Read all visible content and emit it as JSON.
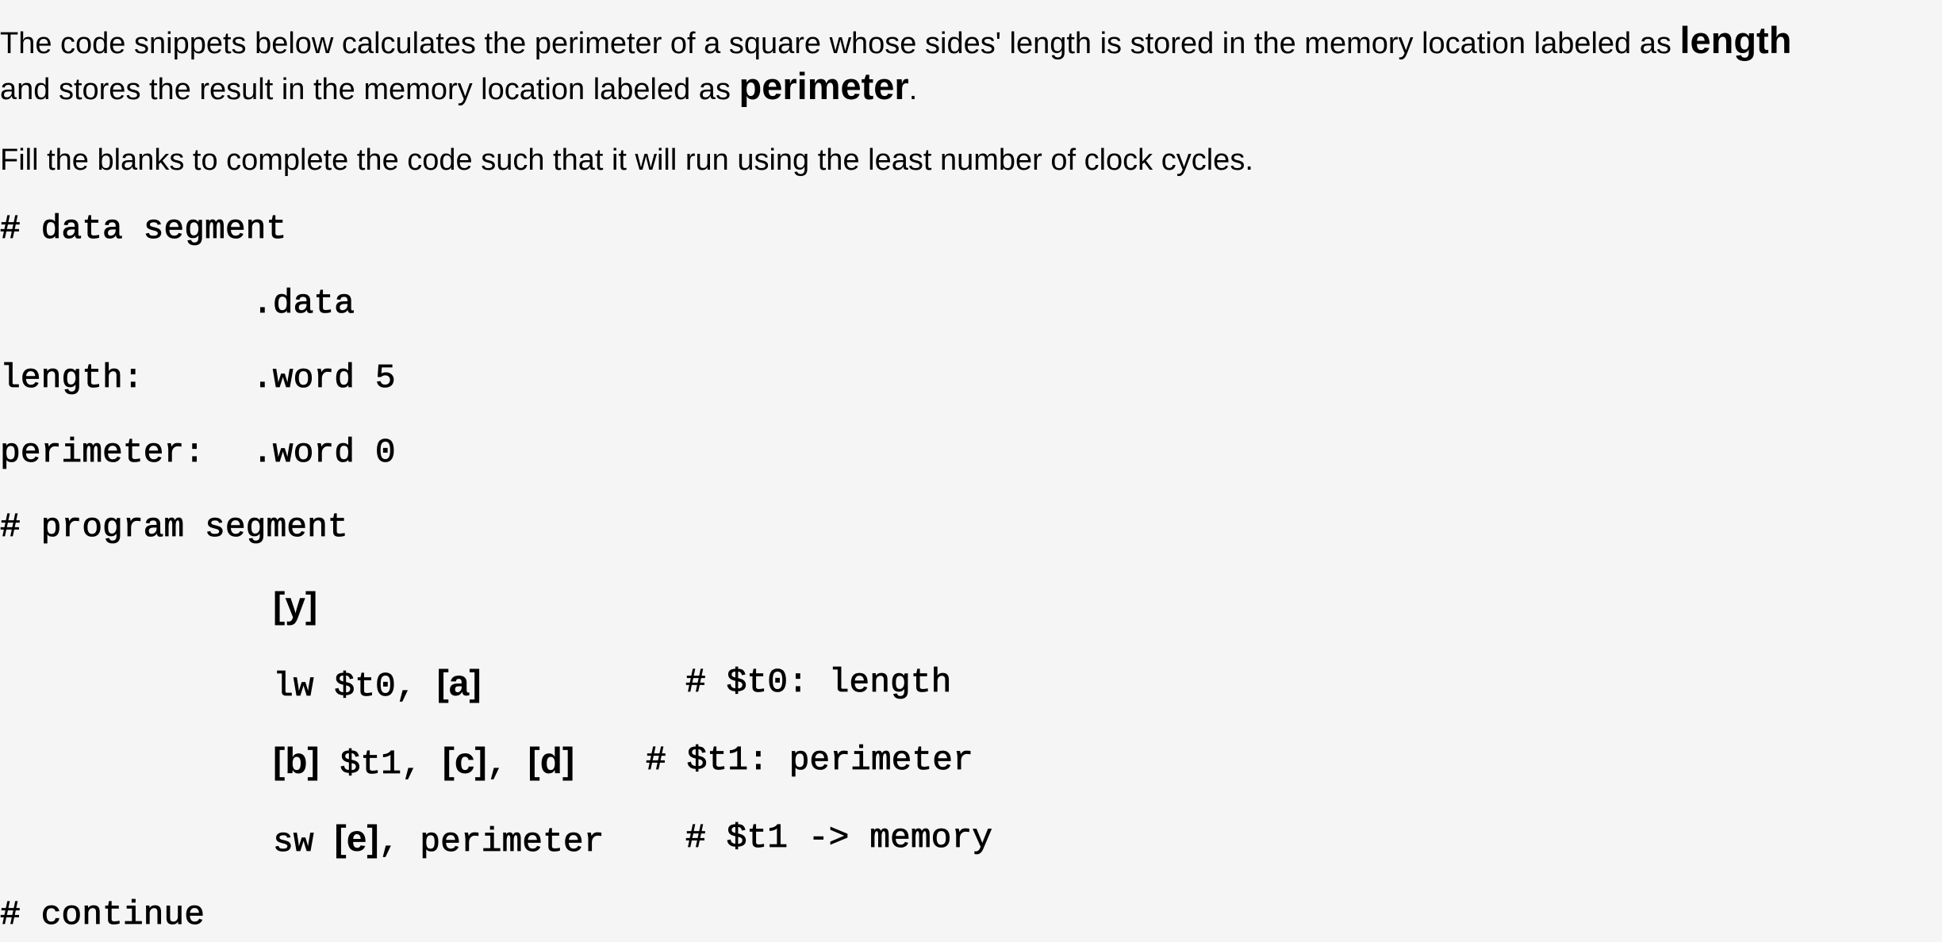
{
  "intro": {
    "line1_text": "The code snippets below calculates the perimeter of a square whose sides' length is stored in the memory location labeled as ",
    "line1_keyword": "length",
    "line2_text": "and stores the result in the memory location labeled as ",
    "line2_keyword": "perimeter",
    "line2_end": "."
  },
  "instruction": "Fill the blanks to complete the code such that it will run using the least number of clock cycles.",
  "code": {
    "data_comment": "# data segment",
    "data_directive": ".data",
    "length_label": "length:",
    "length_decl": ".word 5",
    "perimeter_label": "perimeter:",
    "perimeter_decl": ".word 0",
    "program_comment": "# program segment",
    "blank_y": "[y]",
    "lw_op": "lw $t0, ",
    "blank_a": "[a]",
    "lw_comment": "# $t0: length",
    "blank_b": "[b]",
    "mid_t1": " $t1, ",
    "blank_c": "[c]",
    "mid_comma": ", ",
    "blank_d": "[d]",
    "mid_comment": "# $t1: perimeter",
    "sw_op": "sw ",
    "blank_e": "[e]",
    "sw_rest": ", perimeter",
    "sw_comment": "# $t1 -> memory",
    "continue_comment": "# continue"
  }
}
